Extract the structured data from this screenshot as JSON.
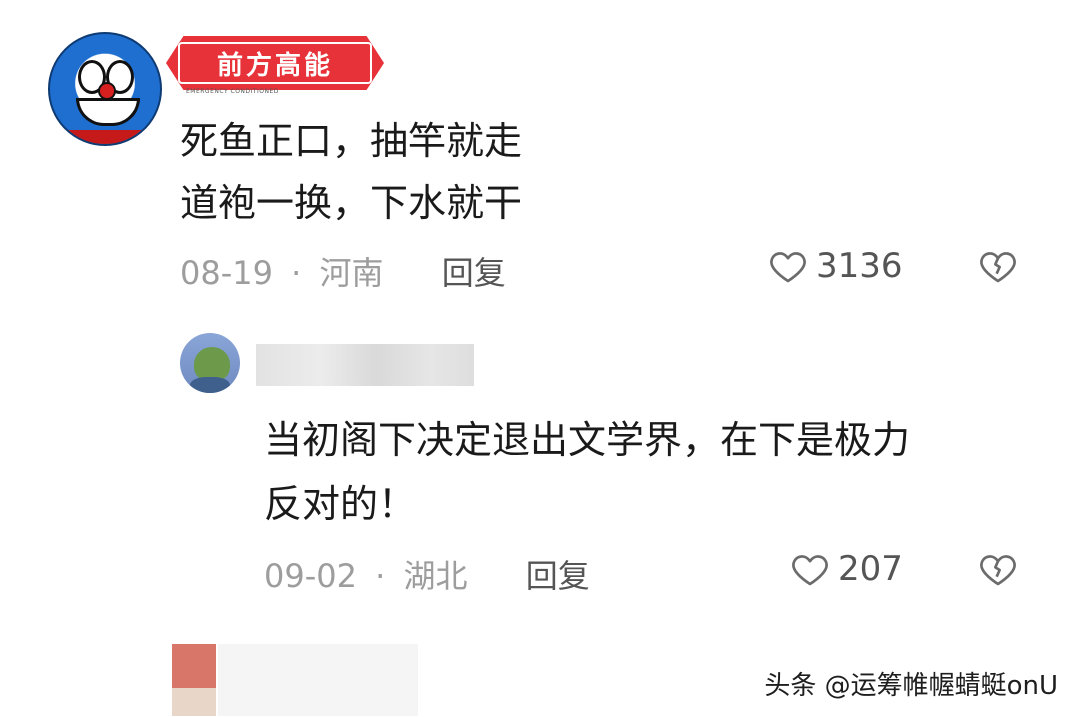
{
  "comments": [
    {
      "badge": "前方高能",
      "badge_sub": "EMERGENCY CONDITIONED",
      "text_lines": [
        "死鱼正口，抽竿就走",
        "道袍一换，下水就干"
      ],
      "date": "08-19",
      "location": "河南",
      "reply_label": "回复",
      "likes": "3136"
    },
    {
      "text_lines": [
        "当初阁下决定退出文学界，在下是极力",
        "反对的！"
      ],
      "date": "09-02",
      "location": "湖北",
      "reply_label": "回复",
      "likes": "207"
    }
  ],
  "meta_separator": "·",
  "watermark": "头条 @运筹帷幄蜻蜓onU",
  "icons": {
    "like": "heart-outline-icon",
    "dislike": "broken-heart-icon"
  }
}
